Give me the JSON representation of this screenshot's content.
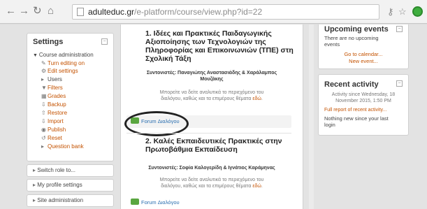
{
  "browser": {
    "url_host": "adulteduc.gr",
    "url_path": "/e-platform/course/view.php?id=22"
  },
  "settings": {
    "title": "Settings",
    "course_admin": "Course administration",
    "items": [
      {
        "label": "Turn editing on",
        "icon": "pencil-icon"
      },
      {
        "label": "Edit settings",
        "icon": "gear-icon"
      },
      {
        "label": "Users",
        "icon": "triangle-right-icon"
      },
      {
        "label": "Filters",
        "icon": "filter-icon"
      },
      {
        "label": "Grades",
        "icon": "grades-icon"
      },
      {
        "label": "Backup",
        "icon": "backup-icon"
      },
      {
        "label": "Restore",
        "icon": "restore-icon"
      },
      {
        "label": "Import",
        "icon": "import-icon"
      },
      {
        "label": "Publish",
        "icon": "publish-icon"
      },
      {
        "label": "Reset",
        "icon": "reset-icon"
      },
      {
        "label": "Question bank",
        "icon": "triangle-right-icon"
      }
    ],
    "switch_role": "Switch role to...",
    "profile_settings": "My profile settings",
    "site_admin": "Site administration"
  },
  "sections": [
    {
      "title_lines": [
        "1. Ιδέες και Πρακτικές Παιδαγωγικής",
        "Αξιοποίησης των Τεχνολογιών της",
        "Πληροφορίας και Επικοινωνιών (ΤΠΕ) στη",
        "Σχολική Τάξη"
      ],
      "coord_lines": [
        "Συντονιστές: Παναγιώτης Αναστασιάδης & Χαράλαμπος",
        "Μουζάκης"
      ],
      "notice_lines": [
        "Μπορείτε να δείτε αναλυτικά το περιεχόμενο του",
        "διαλόγου, καθώς και τα επιμέρους θέματα"
      ],
      "notice_link": "εδώ",
      "forum": "Forum Διαλόγου"
    },
    {
      "title_lines": [
        "2. Καλές Εκπαιδευτικές Πρακτικές στην",
        "Πρωτοβάθμια Εκπαίδευση"
      ],
      "coord_lines": [
        "Συντονιστές: Σοφία Καλογερίδη & Ιγνάτιος Καράμηνας"
      ],
      "notice_lines": [
        "Μπορείτε να δείτε αναλυτικά το περιεχόμενο του",
        "διαλόγου, καθώς και τα επιμέρους θέματα"
      ],
      "notice_link": "εδώ",
      "forum": "Forum Διαλόγου"
    }
  ],
  "upcoming": {
    "title": "Upcoming events",
    "empty_lines": [
      "There are no upcoming",
      "events"
    ],
    "goto_calendar": "Go to calendar...",
    "new_event": "New event..."
  },
  "recent": {
    "title": "Recent activity",
    "since_lines": [
      "Activity since Wednesday, 18",
      "November 2015, 1:50 PM"
    ],
    "full_report": "Full report of recent activity...",
    "nothing_lines": [
      "Nothing new since your last",
      "login"
    ]
  }
}
